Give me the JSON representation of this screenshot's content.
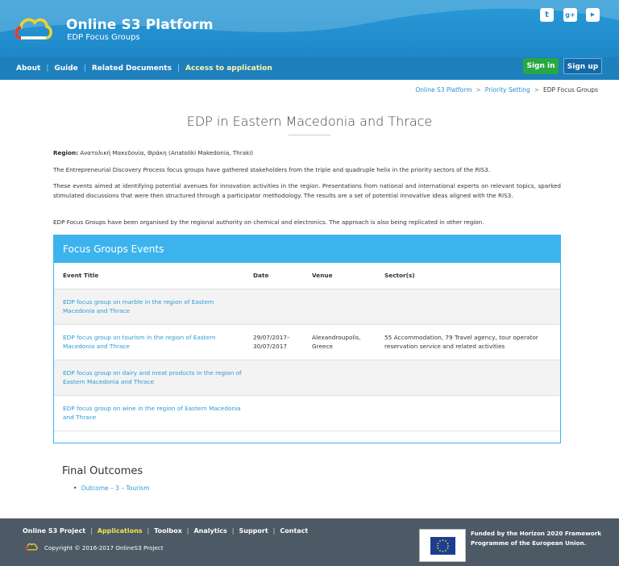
{
  "brand": {
    "title": "Online S3 Platform",
    "subtitle": "EDP Focus Groups"
  },
  "social": [
    {
      "icon": "twitter-icon",
      "glyph": "t"
    },
    {
      "icon": "google-plus-icon",
      "glyph": "g+"
    },
    {
      "icon": "youtube-icon",
      "glyph": "▶"
    }
  ],
  "nav": {
    "about": "About",
    "guide": "Guide",
    "related": "Related Documents",
    "access": "Access to application",
    "sign_in": "Sign in",
    "sign_up": "Sign up"
  },
  "breadcrumb": {
    "home": "Online S3 Platform",
    "section": "Priority Setting",
    "current": "EDP Focus Groups"
  },
  "page": {
    "title": "EDP in Eastern Macedonia and Thrace",
    "region_label": "Region:",
    "region_value": " Ανατολική Μακεδονία, Θράκη (Anatoliki Makedonia, Thraki)",
    "intro": "The Entrepreneurial Discovery Process focus groups have gathered stakeholders from the triple and quadruple helix in the priority sectors of the RIS3.",
    "events_text": "These events aimed at identifying potential avenues for innovation activities in the region. Presentations from national and international experts on relevant topics, sparked stimulated discussions that were then structured through a participator methodology. The results are a set of potential innovative ideas aligned with the RIS3.",
    "organised": "EDP Focus Groups have been organised by the regional authority on chemical and electronics. The approach is also being replicated in other region."
  },
  "panel": {
    "title": "Focus Groups Events",
    "columns": [
      "Event Title",
      "Date",
      "Venue",
      "Sector(s)"
    ],
    "rows": [
      {
        "title": "EDP focus group on marble in the region of Eastern Macedonia and Thrace",
        "date": "",
        "venue": "",
        "sectors": ""
      },
      {
        "title": "EDP focus group on tourism in the region of Eastern Macedonia and Thrace",
        "date": "29/07/2017– 30/07/2017",
        "venue": "Alexandroupolis, Greece",
        "sectors": "55 Accommodation, 79 Travel agency, tour operator reservation service and related activities"
      },
      {
        "title": "EDP focus group on dairy and meat products in the region of Eastern Macedonia and Thrace",
        "date": "",
        "venue": "",
        "sectors": ""
      },
      {
        "title": "EDP focus group on wine in the region of Eastern Macedonia and Thrace",
        "date": "",
        "venue": "",
        "sectors": ""
      }
    ]
  },
  "final": {
    "title": "Final Outcomes",
    "items": [
      "Outcome – 3 – Tourism"
    ]
  },
  "footer": {
    "project": "Online S3 Project",
    "applications": "Applications",
    "toolbox": "Toolbox",
    "analytics": "Analytics",
    "support": "Support",
    "contact": "Contact",
    "copyright": "Copyright © 2016-2017 OnlineS3 Project",
    "funded_1": "Funded by the Horizon 2020 Framework",
    "funded_2": "Programme of the European Union.",
    "eu_caption": "European Commission"
  },
  "colors": {
    "header_blue": "#2a9ad7",
    "panel_blue": "#3db3ee",
    "sign_in_green": "#27a844",
    "footer_gray": "#4d5a66",
    "highlight_yellow": "#f7e24b"
  }
}
